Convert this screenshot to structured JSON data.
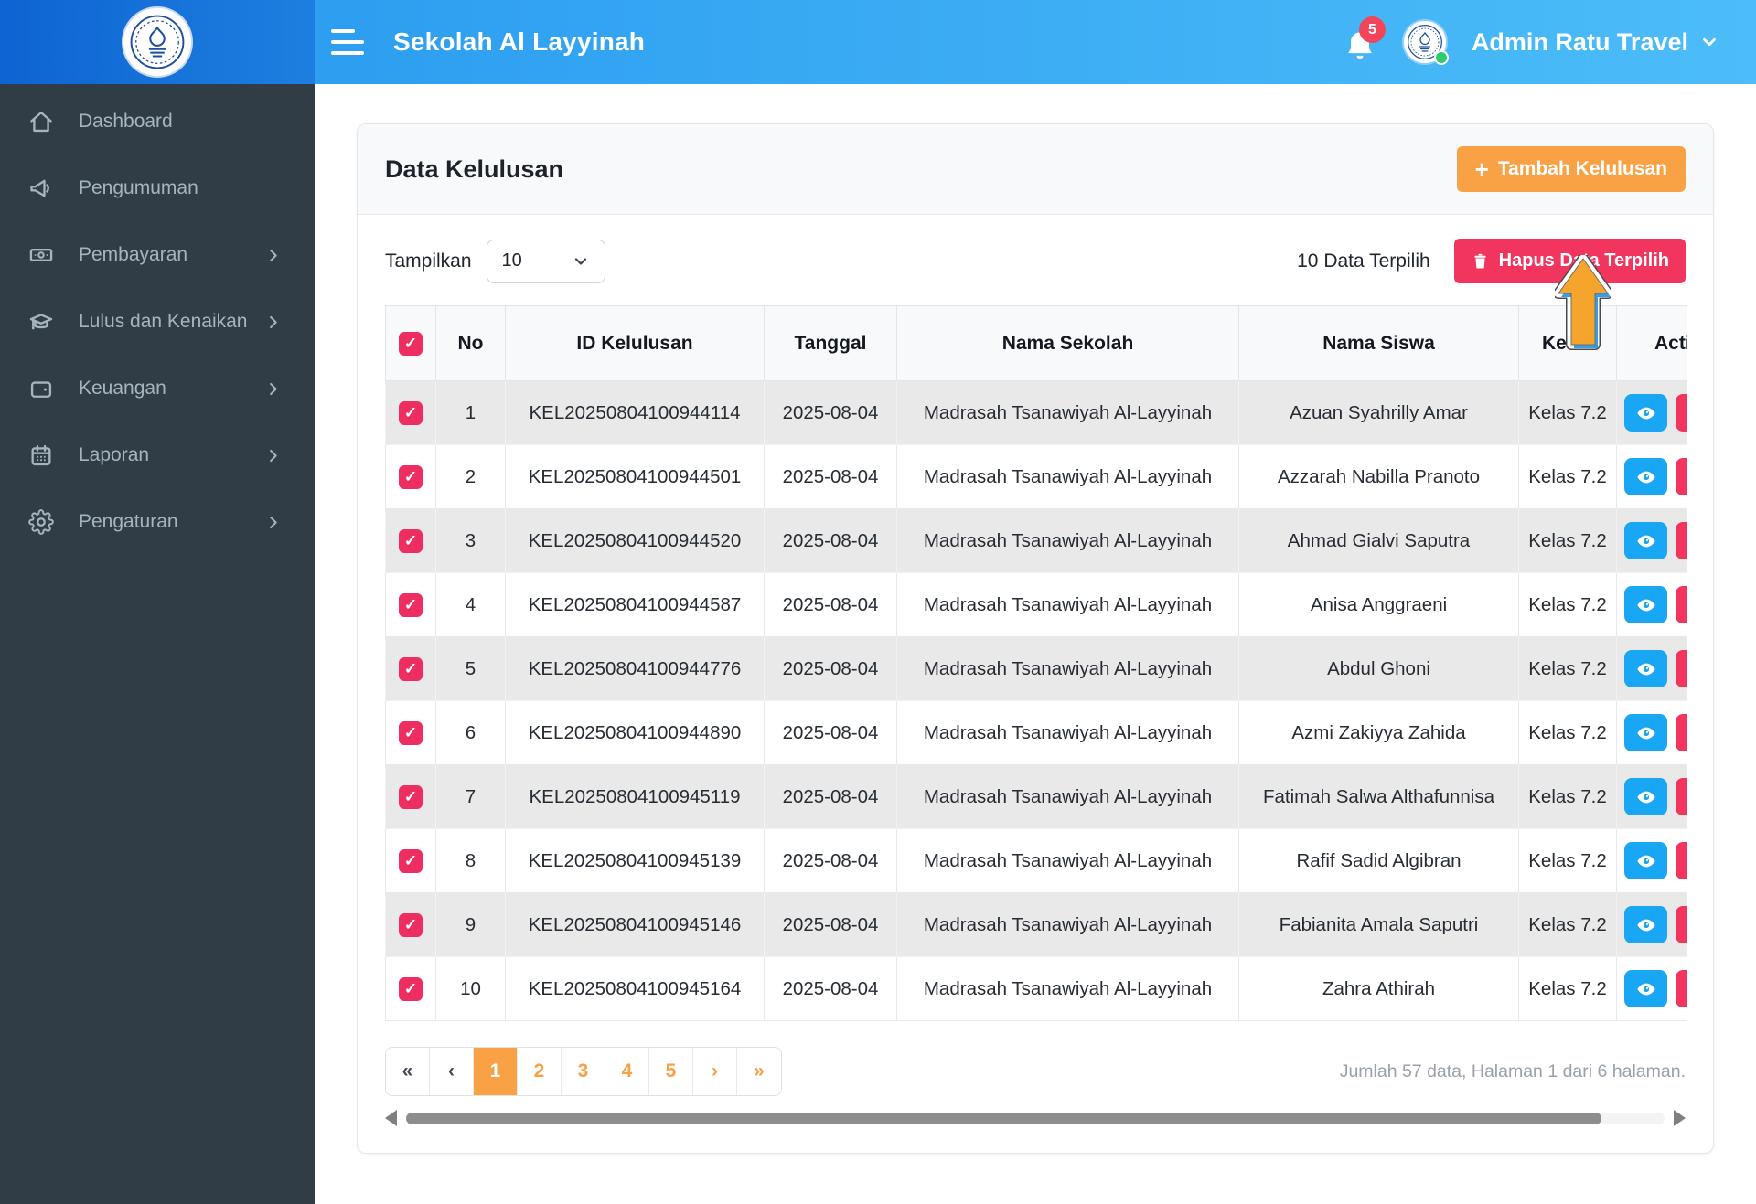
{
  "header": {
    "title": "Sekolah Al Layyinah",
    "notification_count": "5",
    "user_name": "Admin Ratu Travel"
  },
  "sidebar": {
    "items": [
      {
        "label": "Dashboard",
        "icon": "home-icon",
        "has_submenu": false
      },
      {
        "label": "Pengumuman",
        "icon": "megaphone-icon",
        "has_submenu": false
      },
      {
        "label": "Pembayaran",
        "icon": "banknote-icon",
        "has_submenu": true
      },
      {
        "label": "Lulus dan Kenaikan",
        "icon": "graduation-cap-icon",
        "has_submenu": true
      },
      {
        "label": "Keuangan",
        "icon": "wallet-icon",
        "has_submenu": true
      },
      {
        "label": "Laporan",
        "icon": "calendar-icon",
        "has_submenu": true
      },
      {
        "label": "Pengaturan",
        "icon": "gear-icon",
        "has_submenu": true
      }
    ]
  },
  "page": {
    "card_title": "Data Kelulusan",
    "add_button_label": "Tambah Kelulusan",
    "show_label": "Tampilkan",
    "page_size": "10",
    "selected_count_label": "10 Data Terpilih",
    "delete_selected_label": "Hapus Data Terpilih",
    "table": {
      "columns": [
        "No",
        "ID Kelulusan",
        "Tanggal",
        "Nama Sekolah",
        "Nama Siswa",
        "Kelas",
        "Actions"
      ],
      "rows": [
        {
          "no": "1",
          "id": "KEL20250804100944114",
          "date": "2025-08-04",
          "school": "Madrasah Tsanawiyah Al-Layyinah",
          "student": "Azuan Syahrilly Amar",
          "class": "Kelas 7.2",
          "checked": true
        },
        {
          "no": "2",
          "id": "KEL20250804100944501",
          "date": "2025-08-04",
          "school": "Madrasah Tsanawiyah Al-Layyinah",
          "student": "Azzarah Nabilla Pranoto",
          "class": "Kelas 7.2",
          "checked": true
        },
        {
          "no": "3",
          "id": "KEL20250804100944520",
          "date": "2025-08-04",
          "school": "Madrasah Tsanawiyah Al-Layyinah",
          "student": "Ahmad Gialvi Saputra",
          "class": "Kelas 7.2",
          "checked": true
        },
        {
          "no": "4",
          "id": "KEL20250804100944587",
          "date": "2025-08-04",
          "school": "Madrasah Tsanawiyah Al-Layyinah",
          "student": "Anisa Anggraeni",
          "class": "Kelas 7.2",
          "checked": true
        },
        {
          "no": "5",
          "id": "KEL20250804100944776",
          "date": "2025-08-04",
          "school": "Madrasah Tsanawiyah Al-Layyinah",
          "student": "Abdul Ghoni",
          "class": "Kelas 7.2",
          "checked": true
        },
        {
          "no": "6",
          "id": "KEL20250804100944890",
          "date": "2025-08-04",
          "school": "Madrasah Tsanawiyah Al-Layyinah",
          "student": "Azmi Zakiyya Zahida",
          "class": "Kelas 7.2",
          "checked": true
        },
        {
          "no": "7",
          "id": "KEL20250804100945119",
          "date": "2025-08-04",
          "school": "Madrasah Tsanawiyah Al-Layyinah",
          "student": "Fatimah Salwa Althafunnisa",
          "class": "Kelas 7.2",
          "checked": true
        },
        {
          "no": "8",
          "id": "KEL20250804100945139",
          "date": "2025-08-04",
          "school": "Madrasah Tsanawiyah Al-Layyinah",
          "student": "Rafif Sadid Algibran",
          "class": "Kelas 7.2",
          "checked": true
        },
        {
          "no": "9",
          "id": "KEL20250804100945146",
          "date": "2025-08-04",
          "school": "Madrasah Tsanawiyah Al-Layyinah",
          "student": "Fabianita Amala Saputri",
          "class": "Kelas 7.2",
          "checked": true
        },
        {
          "no": "10",
          "id": "KEL20250804100945164",
          "date": "2025-08-04",
          "school": "Madrasah Tsanawiyah Al-Layyinah",
          "student": "Zahra Athirah",
          "class": "Kelas 7.2",
          "checked": true
        }
      ]
    },
    "pagination": {
      "items": [
        {
          "label": "«",
          "style": "nav-dark",
          "active": false
        },
        {
          "label": "‹",
          "style": "nav-dark",
          "active": false
        },
        {
          "label": "1",
          "style": "page",
          "active": true
        },
        {
          "label": "2",
          "style": "page",
          "active": false
        },
        {
          "label": "3",
          "style": "page",
          "active": false
        },
        {
          "label": "4",
          "style": "page",
          "active": false
        },
        {
          "label": "5",
          "style": "page",
          "active": false
        },
        {
          "label": "›",
          "style": "page",
          "active": false
        },
        {
          "label": "»",
          "style": "page",
          "active": false
        }
      ]
    },
    "summary": "Jumlah 57 data, Halaman 1 dari 6 halaman."
  },
  "colors": {
    "accent_orange": "#f8a145",
    "accent_red": "#f1355f",
    "accent_blue": "#19a6f3",
    "checkbox_pink": "#ee2d60",
    "sidebar_bg": "#303d46",
    "header_blue_light": "#4cbdf8",
    "header_blue_dark": "#0e64d2"
  }
}
